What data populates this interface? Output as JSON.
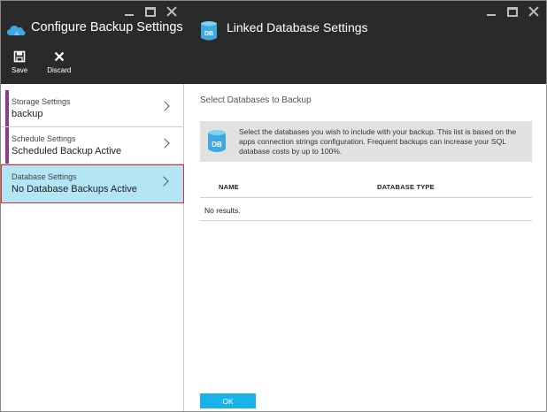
{
  "left_blade": {
    "title": "Configure Backup Settings",
    "toolbar": {
      "save_label": "Save",
      "discard_label": "Discard"
    },
    "settings": [
      {
        "label": "Storage Settings",
        "value": "backup"
      },
      {
        "label": "Schedule Settings",
        "value": "Scheduled Backup Active"
      },
      {
        "label": "Database Settings",
        "value": "No Database Backups Active"
      }
    ]
  },
  "right_blade": {
    "title": "Linked Database Settings",
    "header_icon_text": "DB",
    "section_title": "Select Databases to Backup",
    "info": {
      "icon_text": "DB",
      "text": "Select the databases you wish to include with your backup. This list is based on the apps connection strings configuration. Frequent backups can increase your SQL database costs by up to 100%."
    },
    "table": {
      "columns": [
        "NAME",
        "DATABASE TYPE"
      ],
      "empty_text": "No results."
    },
    "ok_label": "OK"
  },
  "colors": {
    "header_bg": "#2a2a2a",
    "selected_bg": "#b3e5f5",
    "selected_border": "#d9302c",
    "accent_bar": "#8a3c8f",
    "ok_button": "#1ab3e8",
    "db_icon": "#3ea9e0"
  },
  "icons": {
    "app": "cloud-icon",
    "save": "save-icon",
    "discard": "discard-icon",
    "database": "database-icon"
  }
}
